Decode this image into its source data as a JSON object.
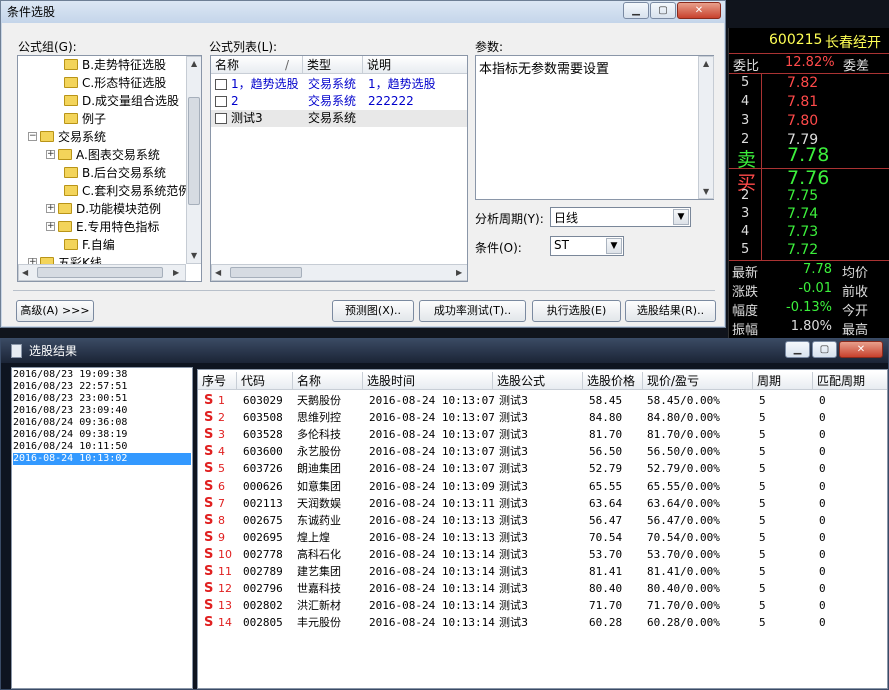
{
  "dialog": {
    "title": "条件选股",
    "group_label": "公式组(G):",
    "list_label": "公式列表(L):",
    "params_label": "参数:",
    "params_text": "本指标无参数需要设置",
    "tree": [
      {
        "label": "B.走势特征选股",
        "indent": 2,
        "expand": ""
      },
      {
        "label": "C.形态特征选股",
        "indent": 2,
        "expand": ""
      },
      {
        "label": "D.成交量组合选股",
        "indent": 2,
        "expand": ""
      },
      {
        "label": "例子",
        "indent": 2,
        "expand": ""
      },
      {
        "label": "交易系统",
        "indent": 0,
        "expand": "−"
      },
      {
        "label": "A.图表交易系统",
        "indent": 1,
        "expand": "+"
      },
      {
        "label": "B.后台交易系统",
        "indent": 2,
        "expand": ""
      },
      {
        "label": "C.套利交易系统范例",
        "indent": 2,
        "expand": ""
      },
      {
        "label": "D.功能模块范例",
        "indent": 1,
        "expand": "+"
      },
      {
        "label": "E.专用特色指标",
        "indent": 1,
        "expand": "+"
      },
      {
        "label": "F.自编",
        "indent": 2,
        "expand": ""
      },
      {
        "label": "五彩K线",
        "indent": 0,
        "expand": "+"
      }
    ],
    "list_headers": {
      "name": "名称",
      "sort": "/",
      "type": "类型",
      "desc": "说明"
    },
    "formulas": [
      {
        "name": "1，趋势选股",
        "type": "交易系统",
        "desc": "1，趋势选股",
        "color": "#0000cc"
      },
      {
        "name": "2",
        "type": "交易系统",
        "desc": "222222",
        "color": "#0000cc"
      },
      {
        "name": "测试3",
        "type": "交易系统",
        "desc": "",
        "color": "#000000"
      }
    ],
    "period_label": "分析周期(Y):",
    "period_value": "日线",
    "condition_label": "条件(O):",
    "condition_value": "ST",
    "buttons": {
      "advanced": "高级(A) >>>",
      "preview": "预测图(X)..",
      "success": "成功率测试(T)..",
      "execute": "执行选股(E)",
      "results": "选股结果(R).."
    }
  },
  "quote": {
    "code": "600215",
    "name": "长春经开",
    "weibi_label": "委比",
    "weibi_value": "12.82%",
    "weicha_label": "委差",
    "sell": [
      {
        "level": "5",
        "price": "7.82",
        "color": "#ff4a4a"
      },
      {
        "level": "4",
        "price": "7.81",
        "color": "#ff4a4a"
      },
      {
        "level": "3",
        "price": "7.80",
        "color": "#ff4a4a"
      },
      {
        "level": "2",
        "price": "7.79",
        "color": "#dddddd"
      }
    ],
    "sell1_label": "卖",
    "sell1_price": "7.78",
    "buy1_label": "买",
    "buy1_price": "7.76",
    "buy": [
      {
        "level": "2",
        "price": "7.75"
      },
      {
        "level": "3",
        "price": "7.74"
      },
      {
        "level": "4",
        "price": "7.73"
      },
      {
        "level": "5",
        "price": "7.72"
      }
    ],
    "stats": [
      {
        "label": "最新",
        "value": "7.78",
        "label2": "均价",
        "color": "#3cf03c"
      },
      {
        "label": "涨跌",
        "value": "-0.01",
        "label2": "前收",
        "color": "#3cf03c"
      },
      {
        "label": "幅度",
        "value": "-0.13%",
        "label2": "今开",
        "color": "#3cf03c"
      },
      {
        "label": "振幅",
        "value": "1.80%",
        "label2": "最高",
        "color": "#dddddd"
      }
    ]
  },
  "results": {
    "title": "选股结果",
    "times": [
      "2016/08/23 19:09:38",
      "2016/08/23 22:57:51",
      "2016/08/23 23:00:51",
      "2016/08/23 23:09:40",
      "2016/08/24 09:36:08",
      "2016/08/24 09:38:19",
      "2016/08/24 10:11:50",
      "2016-08-24 10:13:02"
    ],
    "selected_time_index": 7,
    "headers": [
      "序号",
      "代码",
      "名称",
      "选股时间",
      "选股公式",
      "选股价格",
      "现价/盈亏",
      "周期",
      "匹配周期"
    ],
    "signal": "S",
    "rows": [
      {
        "n": "1",
        "code": "603029",
        "name": "天鹅股份",
        "time": "2016-08-24 10:13:07",
        "formula": "测试3",
        "price": "58.45",
        "now": "58.45/0.00%",
        "period": "5",
        "match": "0"
      },
      {
        "n": "2",
        "code": "603508",
        "name": "思维列控",
        "time": "2016-08-24 10:13:07",
        "formula": "测试3",
        "price": "84.80",
        "now": "84.80/0.00%",
        "period": "5",
        "match": "0"
      },
      {
        "n": "3",
        "code": "603528",
        "name": "多伦科技",
        "time": "2016-08-24 10:13:07",
        "formula": "测试3",
        "price": "81.70",
        "now": "81.70/0.00%",
        "period": "5",
        "match": "0"
      },
      {
        "n": "4",
        "code": "603600",
        "name": "永艺股份",
        "time": "2016-08-24 10:13:07",
        "formula": "测试3",
        "price": "56.50",
        "now": "56.50/0.00%",
        "period": "5",
        "match": "0"
      },
      {
        "n": "5",
        "code": "603726",
        "name": "朗迪集团",
        "time": "2016-08-24 10:13:07",
        "formula": "测试3",
        "price": "52.79",
        "now": "52.79/0.00%",
        "period": "5",
        "match": "0"
      },
      {
        "n": "6",
        "code": "000626",
        "name": "如意集团",
        "time": "2016-08-24 10:13:09",
        "formula": "测试3",
        "price": "65.55",
        "now": "65.55/0.00%",
        "period": "5",
        "match": "0"
      },
      {
        "n": "7",
        "code": "002113",
        "name": "天润数娱",
        "time": "2016-08-24 10:13:11",
        "formula": "测试3",
        "price": "63.64",
        "now": "63.64/0.00%",
        "period": "5",
        "match": "0"
      },
      {
        "n": "8",
        "code": "002675",
        "name": "东诚药业",
        "time": "2016-08-24 10:13:13",
        "formula": "测试3",
        "price": "56.47",
        "now": "56.47/0.00%",
        "period": "5",
        "match": "0"
      },
      {
        "n": "9",
        "code": "002695",
        "name": "煌上煌",
        "time": "2016-08-24 10:13:13",
        "formula": "测试3",
        "price": "70.54",
        "now": "70.54/0.00%",
        "period": "5",
        "match": "0"
      },
      {
        "n": "10",
        "code": "002778",
        "name": "高科石化",
        "time": "2016-08-24 10:13:14",
        "formula": "测试3",
        "price": "53.70",
        "now": "53.70/0.00%",
        "period": "5",
        "match": "0"
      },
      {
        "n": "11",
        "code": "002789",
        "name": "建艺集团",
        "time": "2016-08-24 10:13:14",
        "formula": "测试3",
        "price": "81.41",
        "now": "81.41/0.00%",
        "period": "5",
        "match": "0"
      },
      {
        "n": "12",
        "code": "002796",
        "name": "世嘉科技",
        "time": "2016-08-24 10:13:14",
        "formula": "测试3",
        "price": "80.40",
        "now": "80.40/0.00%",
        "period": "5",
        "match": "0"
      },
      {
        "n": "13",
        "code": "002802",
        "name": "洪汇新材",
        "time": "2016-08-24 10:13:14",
        "formula": "测试3",
        "price": "71.70",
        "now": "71.70/0.00%",
        "period": "5",
        "match": "0"
      },
      {
        "n": "14",
        "code": "002805",
        "name": "丰元股份",
        "time": "2016-08-24 10:13:14",
        "formula": "测试3",
        "price": "60.28",
        "now": "60.28/0.00%",
        "period": "5",
        "match": "0"
      }
    ]
  }
}
